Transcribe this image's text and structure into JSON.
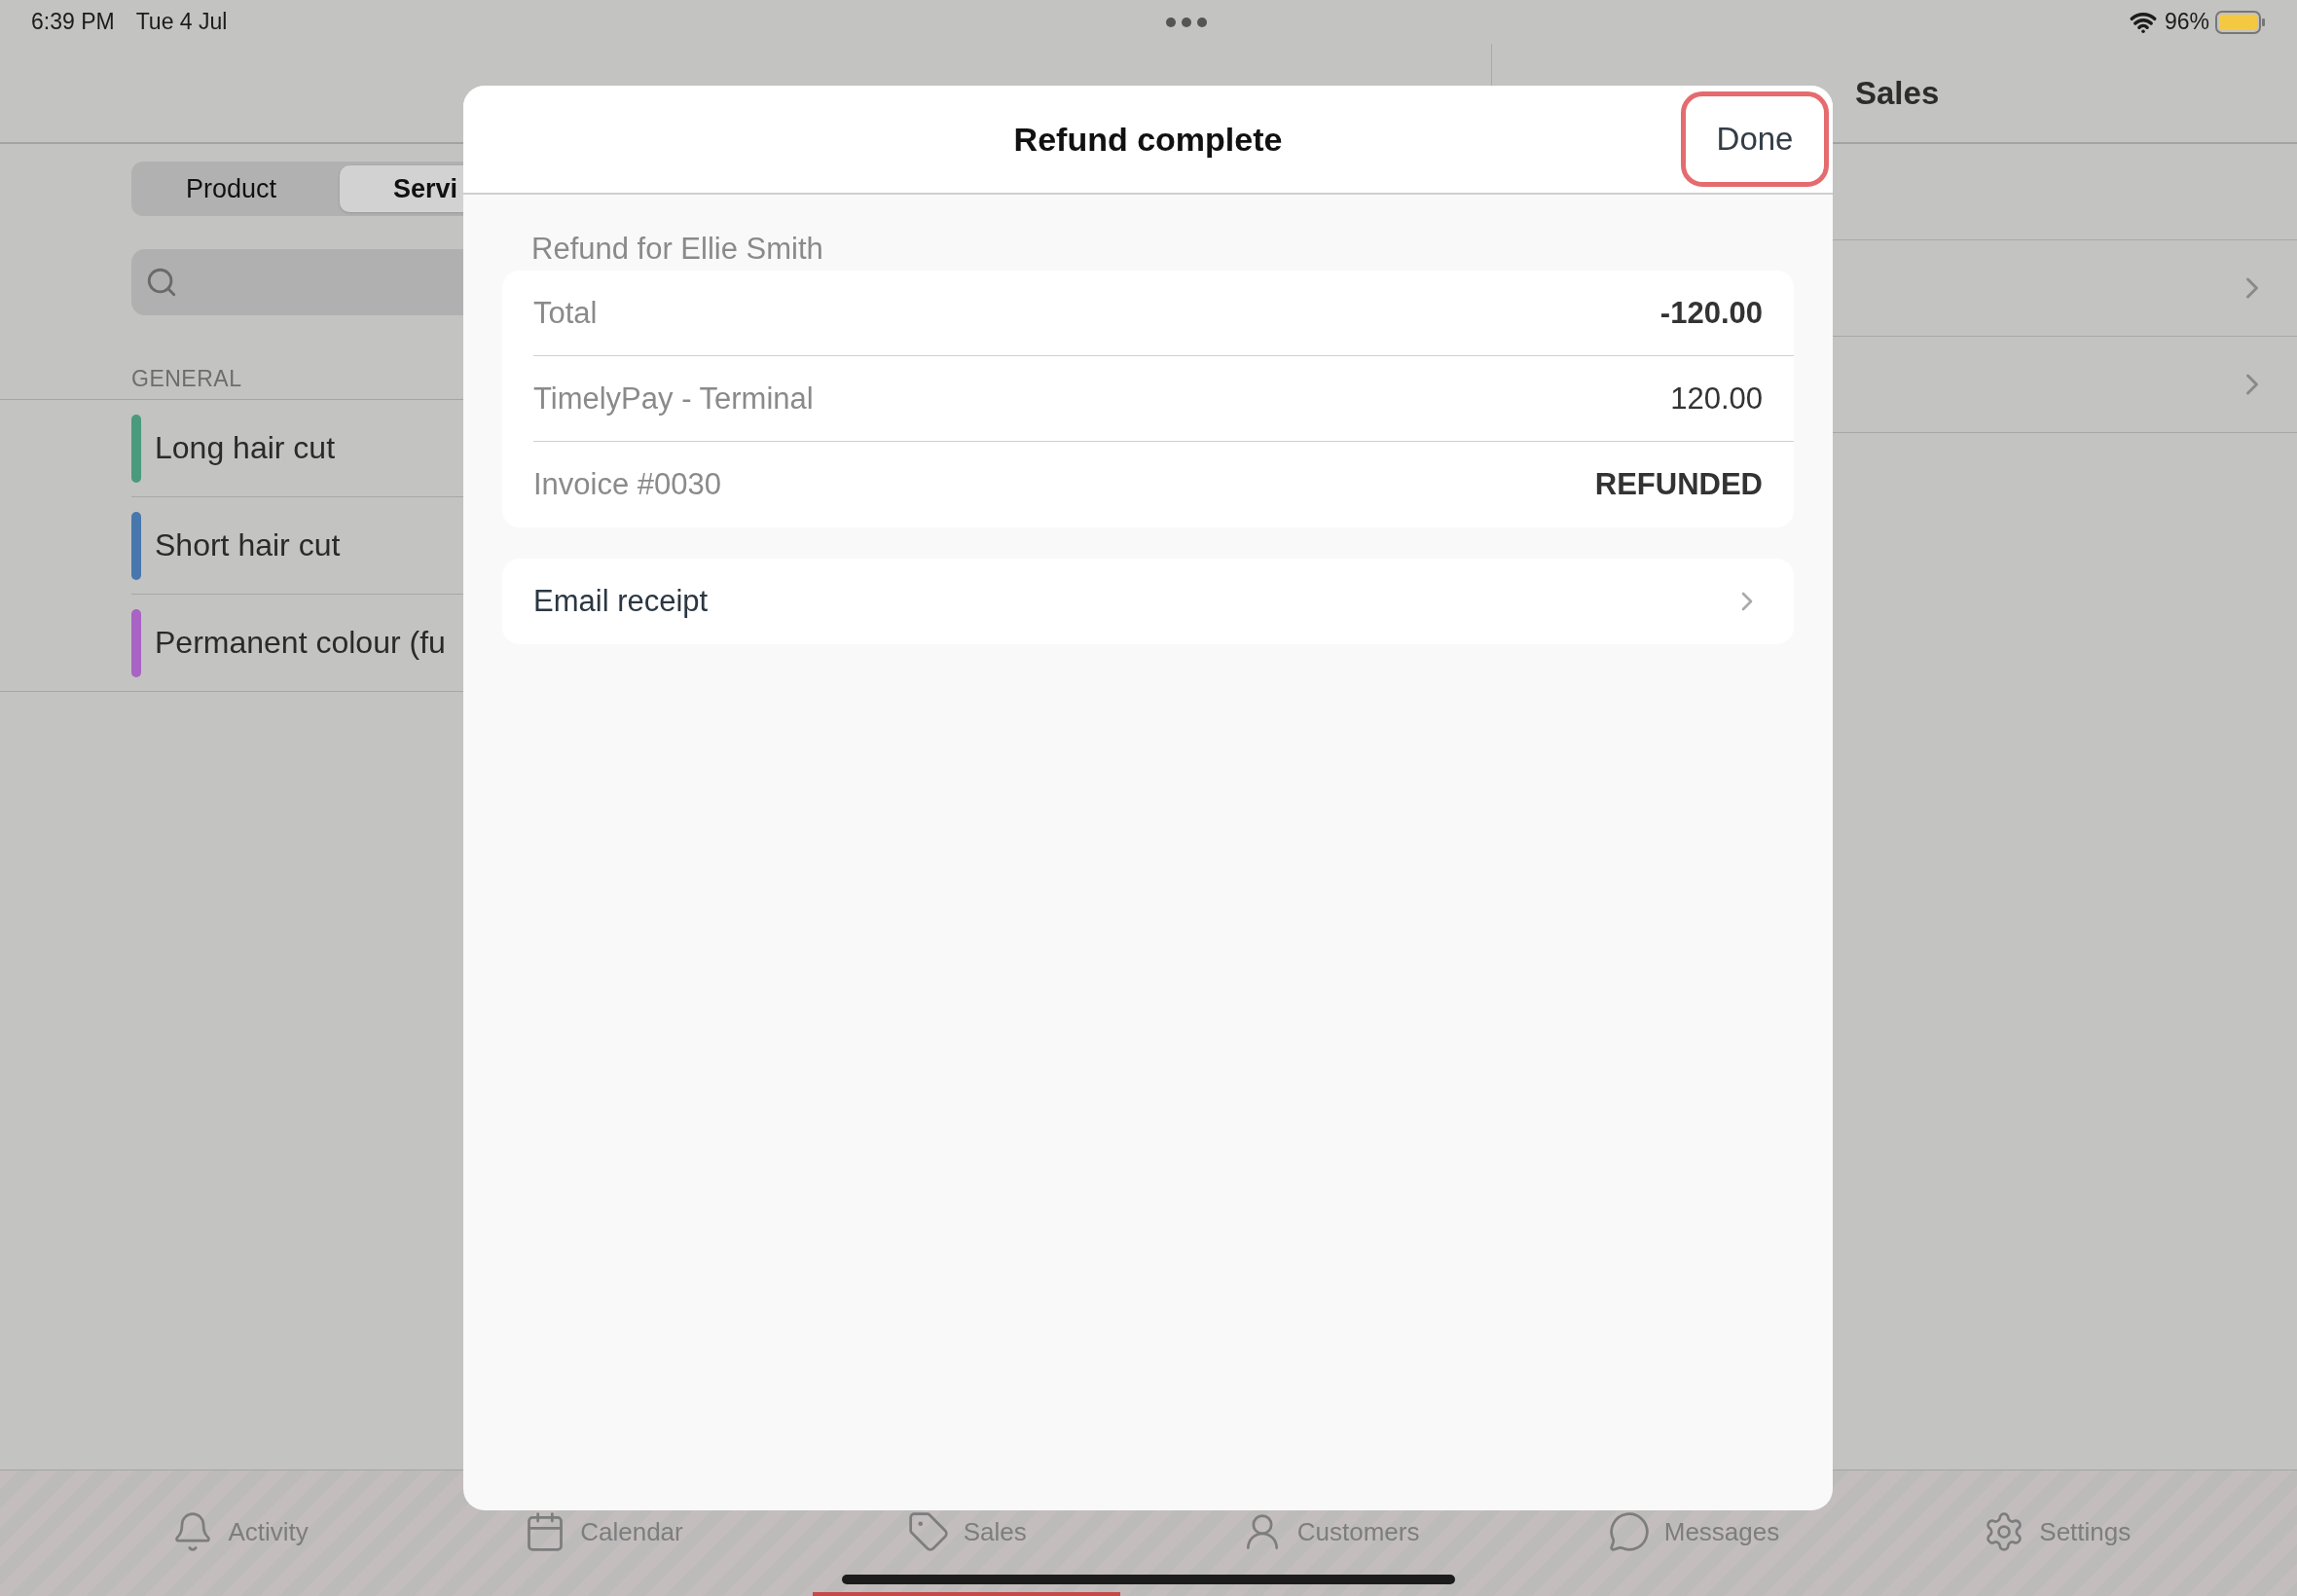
{
  "status_bar": {
    "time": "6:39 PM",
    "date": "Tue 4 Jul",
    "battery": "96%"
  },
  "left_panel": {
    "segments": [
      {
        "label": "Product",
        "selected": false
      },
      {
        "label": "Servi",
        "selected": true
      }
    ],
    "section": "GENERAL",
    "items": [
      {
        "name": "Long hair cut",
        "color": "#4a9a7c"
      },
      {
        "name": "Short hair cut",
        "color": "#4777ad"
      },
      {
        "name": "Permanent colour (fu",
        "color": "#a863c4"
      }
    ]
  },
  "right_panel": {
    "title": "Sales",
    "rows": [
      {
        "chevron": false
      },
      {
        "chevron": true
      },
      {
        "chevron": true
      }
    ]
  },
  "modal": {
    "title": "Refund complete",
    "done": "Done",
    "section": "Refund for Ellie Smith",
    "rows": [
      {
        "label": "Total",
        "value": "-120.00",
        "bold": true
      },
      {
        "label": "TimelyPay - Terminal",
        "value": "120.00",
        "bold": false
      },
      {
        "label": "Invoice #0030",
        "value": "REFUNDED",
        "bold": true
      }
    ],
    "action": "Email receipt"
  },
  "tab_bar": [
    {
      "label": "Activity",
      "selected": false
    },
    {
      "label": "Calendar",
      "selected": false
    },
    {
      "label": "Sales",
      "selected": true
    },
    {
      "label": "Customers",
      "selected": false
    },
    {
      "label": "Messages",
      "selected": false
    },
    {
      "label": "Settings",
      "selected": false
    }
  ]
}
